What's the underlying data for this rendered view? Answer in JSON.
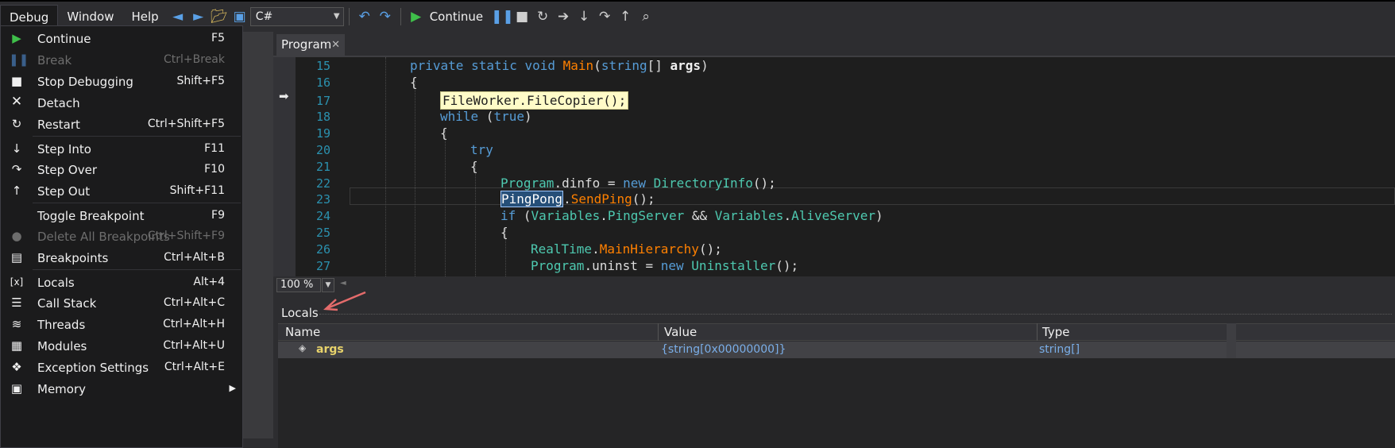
{
  "menubar": {
    "menus": [
      "Debug",
      "Window",
      "Help"
    ],
    "language": "C#",
    "continue_label": "Continue"
  },
  "debug_menu": {
    "items": [
      {
        "label": "Continue",
        "shortcut": "F5",
        "icon": "play-icon",
        "enabled": true
      },
      {
        "label": "Break",
        "shortcut": "Ctrl+Break",
        "icon": "pause-icon",
        "enabled": false
      },
      {
        "label": "Stop Debugging",
        "shortcut": "Shift+F5",
        "icon": "stop-icon",
        "enabled": true
      },
      {
        "label": "Detach",
        "shortcut": "",
        "icon": "detach-x-icon",
        "enabled": true
      },
      {
        "label": "Restart",
        "shortcut": "Ctrl+Shift+F5",
        "icon": "restart-icon",
        "enabled": true
      },
      {
        "label": "Step Into",
        "shortcut": "F11",
        "icon": "step-into-icon",
        "enabled": true
      },
      {
        "label": "Step Over",
        "shortcut": "F10",
        "icon": "step-over-icon",
        "enabled": true
      },
      {
        "label": "Step Out",
        "shortcut": "Shift+F11",
        "icon": "step-out-icon",
        "enabled": true
      },
      {
        "label": "Toggle Breakpoint",
        "shortcut": "F9",
        "icon": "",
        "enabled": true
      },
      {
        "label": "Delete All Breakpoints",
        "shortcut": "Ctrl+Shift+F9",
        "icon": "delete-breakpoints-icon",
        "enabled": false
      },
      {
        "label": "Breakpoints",
        "shortcut": "Ctrl+Alt+B",
        "icon": "breakpoints-window-icon",
        "enabled": true
      },
      {
        "label": "Locals",
        "shortcut": "Alt+4",
        "icon": "locals-icon",
        "enabled": true
      },
      {
        "label": "Call Stack",
        "shortcut": "Ctrl+Alt+C",
        "icon": "call-stack-icon",
        "enabled": true
      },
      {
        "label": "Threads",
        "shortcut": "Ctrl+Alt+H",
        "icon": "threads-icon",
        "enabled": true
      },
      {
        "label": "Modules",
        "shortcut": "Ctrl+Alt+U",
        "icon": "modules-icon",
        "enabled": true
      },
      {
        "label": "Exception Settings",
        "shortcut": "Ctrl+Alt+E",
        "icon": "exception-settings-icon",
        "enabled": true
      },
      {
        "label": "Memory",
        "shortcut": "",
        "icon": "memory-icon",
        "enabled": true,
        "submenu": true
      }
    ]
  },
  "editor": {
    "tab_label": "Program",
    "zoom": "100 %",
    "lines": [
      {
        "num": "15",
        "parts": [
          [
            "kw",
            "private static void "
          ],
          [
            "mt",
            "Main"
          ],
          [
            "tx",
            "("
          ],
          [
            "kw",
            "string"
          ],
          [
            "tx",
            "[] "
          ],
          [
            "pm",
            "args"
          ],
          [
            "tx",
            ")"
          ]
        ]
      },
      {
        "num": "16",
        "parts": [
          [
            "tx",
            "{"
          ]
        ]
      },
      {
        "num": "17",
        "parts": [
          [
            "ty",
            "FileWorker"
          ],
          [
            "tx",
            "."
          ],
          [
            "mt",
            "FileCopier"
          ],
          [
            "tx",
            "();"
          ]
        ]
      },
      {
        "num": "18",
        "parts": [
          [
            "kw",
            "while"
          ],
          [
            "tx",
            " ("
          ],
          [
            "kw",
            "true"
          ],
          [
            "tx",
            ")"
          ]
        ]
      },
      {
        "num": "19",
        "parts": [
          [
            "tx",
            "{"
          ]
        ]
      },
      {
        "num": "20",
        "parts": [
          [
            "kw",
            "try"
          ]
        ]
      },
      {
        "num": "21",
        "parts": [
          [
            "tx",
            "{"
          ]
        ]
      },
      {
        "num": "22",
        "parts": [
          [
            "ty",
            "Program"
          ],
          [
            "tx",
            ".dinfo = "
          ],
          [
            "kw",
            "new "
          ],
          [
            "ty",
            "DirectoryInfo"
          ],
          [
            "tx",
            "();"
          ]
        ]
      },
      {
        "num": "23",
        "parts": [
          [
            "ty",
            "PingPong"
          ],
          [
            "tx",
            "."
          ],
          [
            "mt",
            "SendPing"
          ],
          [
            "tx",
            "();"
          ]
        ]
      },
      {
        "num": "24",
        "parts": [
          [
            "kw",
            "if"
          ],
          [
            "tx",
            " ("
          ],
          [
            "ty",
            "Variables"
          ],
          [
            "tx",
            "."
          ],
          [
            "ty",
            "PingServer"
          ],
          [
            "tx",
            " && "
          ],
          [
            "ty",
            "Variables"
          ],
          [
            "tx",
            "."
          ],
          [
            "ty",
            "AliveServer"
          ],
          [
            "tx",
            ")"
          ]
        ]
      },
      {
        "num": "25",
        "parts": [
          [
            "tx",
            "{"
          ]
        ]
      },
      {
        "num": "26",
        "parts": [
          [
            "ty",
            "RealTime"
          ],
          [
            "tx",
            "."
          ],
          [
            "mt",
            "MainHierarchy"
          ],
          [
            "tx",
            "();"
          ]
        ]
      },
      {
        "num": "27",
        "parts": [
          [
            "ty",
            "Program"
          ],
          [
            "tx",
            ".uninst = "
          ],
          [
            "kw",
            "new "
          ],
          [
            "ty",
            "Uninstaller"
          ],
          [
            "tx",
            "();"
          ]
        ]
      }
    ]
  },
  "locals": {
    "title": "Locals",
    "columns": [
      "Name",
      "Value",
      "Type"
    ],
    "rows": [
      {
        "name": "args",
        "value": "{string[0x00000000]}",
        "type": "string[]"
      }
    ]
  },
  "colors": {
    "keyword": "#569cd6",
    "type": "#4ec9b0",
    "method": "#ff8000",
    "line_number": "#2b91af",
    "current_statement": "#fffbc8",
    "annotation_arrow": "#e46b6b"
  }
}
